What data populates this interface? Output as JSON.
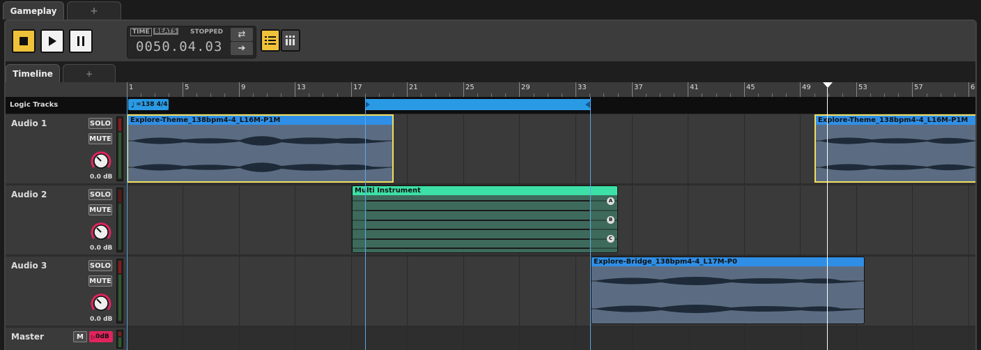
{
  "top_tabs": {
    "active": "Gameplay",
    "add": "+"
  },
  "transport": {
    "time_label": "TIME",
    "beats_label": "BEATS",
    "status": "STOPPED",
    "position": "0050.04.03"
  },
  "sub_tabs": {
    "active": "Timeline",
    "add": "+"
  },
  "ruler": {
    "ticks": [
      "1",
      "5",
      "9",
      "13",
      "17",
      "21",
      "25",
      "29",
      "33",
      "37",
      "41",
      "45",
      "49",
      "53",
      "57",
      "6"
    ]
  },
  "logic": {
    "label": "Logic Tracks",
    "tempo": "=138 4/4"
  },
  "tracks": [
    {
      "name": "Audio 1",
      "solo": "SOLO",
      "mute": "MUTE",
      "gain": "0.0 dB"
    },
    {
      "name": "Audio 2",
      "solo": "SOLO",
      "mute": "MUTE",
      "gain": "0.0 dB"
    },
    {
      "name": "Audio 3",
      "solo": "SOLO",
      "mute": "MUTE",
      "gain": "0.0 dB"
    }
  ],
  "master": {
    "name": "Master",
    "m": "M",
    "gain": "0dB"
  },
  "clips": {
    "audio1_a": "Explore-Theme_138bpm4-4_L16M-P1M",
    "audio1_b": "Explore-Theme_138bpm4-4_L16M-P1M",
    "multi": "Multi Instrument",
    "multi_rows": [
      "A",
      "B",
      "C"
    ],
    "audio3": "Explore-Bridge_138bpm4-4_L17M-P0"
  },
  "colors": {
    "accent": "#f0c23a",
    "clip_blue": "#2f8fe6",
    "multi_green": "#3de0a6",
    "loop": "#2a9ae4"
  }
}
